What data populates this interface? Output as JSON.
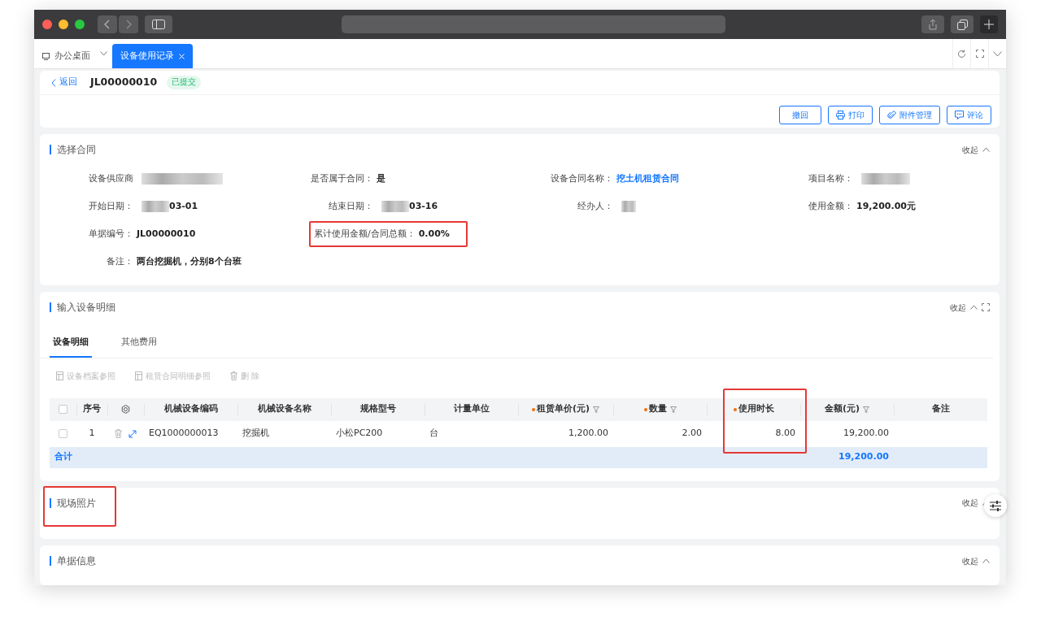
{
  "tabs": [
    {
      "label": "办公桌面",
      "selected": false,
      "closable": false
    },
    {
      "label": "设备使用记录",
      "selected": true,
      "closable": true
    }
  ],
  "header": {
    "back": "返回",
    "title": "JL00000010",
    "status": "已提交"
  },
  "actions": [
    "撤回",
    "打印",
    "附件管理",
    "评论"
  ],
  "contract_section": {
    "title": "选择合同",
    "collapse": "收起",
    "highlighted": false,
    "fields": [
      {
        "label": "设备供应商",
        "blurred": true,
        "highlighted": false,
        "link": false
      },
      {
        "label": "是否属于合同：",
        "value": "是",
        "blurred": false,
        "highlighted": false,
        "link": false
      },
      {
        "label": "设备合同名称：",
        "value": "挖土机租赁合同",
        "blurred": false,
        "highlighted": false,
        "link": true
      },
      {
        "label": "项目名称：",
        "blurred": true,
        "highlighted": false,
        "link": false
      },
      {
        "label": "开始日期：",
        "value": "03-01",
        "blurred": true,
        "highlighted": false,
        "link": false
      },
      {
        "label": "结束日期：",
        "value": "03-16",
        "blurred": true,
        "highlighted": false,
        "link": false
      },
      {
        "label": "经办人：",
        "blurred": true,
        "highlighted": false,
        "link": false
      },
      {
        "label": "使用金额：",
        "value": "19,200.00元",
        "blurred": false,
        "highlighted": false,
        "link": false
      },
      {
        "label": "单据编号：",
        "value": "JL00000010",
        "blurred": false,
        "highlighted": false,
        "link": false
      },
      {
        "label": "累计使用金额/合同总额：",
        "value": "0.00%",
        "blurred": false,
        "highlighted": true,
        "link": false
      },
      {
        "label": "备注：",
        "value": "两台挖掘机，分别8个台班",
        "blurred": false,
        "highlighted": false,
        "link": false
      }
    ]
  },
  "detail_section": {
    "title": "输入设备明细",
    "collapse": "收起",
    "highlighted": false,
    "tabs": [
      {
        "label": "设备明细",
        "selected": true
      },
      {
        "label": "其他费用",
        "selected": false
      }
    ],
    "toolbar": [
      {
        "label": "设备档案参照",
        "disabled": true
      },
      {
        "label": "租赁合同明细参照",
        "disabled": true
      },
      {
        "label": "删 除",
        "disabled": true
      }
    ],
    "all_checked": false,
    "columns": [
      {
        "kind": "text",
        "label": "序号",
        "required": false,
        "filter": false,
        "highlighted": false
      },
      {
        "kind": "gear"
      },
      {
        "kind": "text",
        "label": "机械设备编码",
        "required": false,
        "filter": false,
        "highlighted": false
      },
      {
        "kind": "text",
        "label": "机械设备名称",
        "required": false,
        "filter": false,
        "highlighted": false
      },
      {
        "kind": "text",
        "label": "规格型号",
        "required": false,
        "filter": false,
        "highlighted": false
      },
      {
        "kind": "text",
        "label": "计量单位",
        "required": false,
        "filter": false,
        "highlighted": false
      },
      {
        "kind": "text",
        "label": "租赁单价(元)",
        "required": true,
        "filter": true,
        "highlighted": false
      },
      {
        "kind": "text",
        "label": "数量",
        "required": true,
        "filter": true,
        "highlighted": false
      },
      {
        "kind": "text",
        "label": "使用时长",
        "required": true,
        "filter": false,
        "highlighted": true
      },
      {
        "kind": "text",
        "label": "金额(元)",
        "required": false,
        "filter": true,
        "highlighted": false
      },
      {
        "kind": "text",
        "label": "备注",
        "required": false,
        "filter": false,
        "highlighted": false
      }
    ],
    "rows": [
      {
        "checked": false,
        "cells": [
          "1",
          null,
          "EQ1000000013",
          "挖掘机",
          "小松PC200",
          "台",
          "1,200.00",
          "2.00",
          "8.00",
          "19,200.00",
          null
        ]
      }
    ],
    "total": {
      "label": "合计",
      "amount": "19,200.00"
    }
  },
  "photo_section": {
    "title": "现场照片",
    "collapse": "收起",
    "highlighted": true
  },
  "info_section": {
    "title": "单据信息",
    "collapse": "收起",
    "highlighted": false
  }
}
